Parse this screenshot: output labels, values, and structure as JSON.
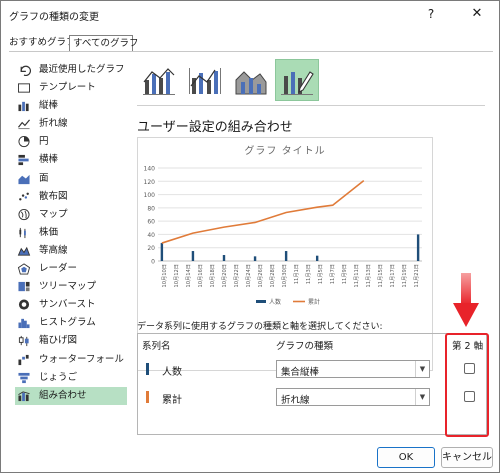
{
  "window": {
    "title": "グラフの種類の変更",
    "help": "?",
    "close": "✕"
  },
  "tabs": {
    "recommended": "おすすめグラフ",
    "all": "すべてのグラフ"
  },
  "sidebar": {
    "items": [
      {
        "label": "最近使用したグラフ",
        "icon": "undo-icon"
      },
      {
        "label": "テンプレート",
        "icon": "folder-icon"
      },
      {
        "label": "縦棒",
        "icon": "column-chart-icon"
      },
      {
        "label": "折れ線",
        "icon": "line-chart-icon"
      },
      {
        "label": "円",
        "icon": "pie-chart-icon"
      },
      {
        "label": "横棒",
        "icon": "bar-chart-icon"
      },
      {
        "label": "面",
        "icon": "area-chart-icon"
      },
      {
        "label": "散布図",
        "icon": "scatter-chart-icon"
      },
      {
        "label": "マップ",
        "icon": "map-chart-icon"
      },
      {
        "label": "株価",
        "icon": "stock-chart-icon"
      },
      {
        "label": "等高線",
        "icon": "surface-chart-icon"
      },
      {
        "label": "レーダー",
        "icon": "radar-chart-icon"
      },
      {
        "label": "ツリーマップ",
        "icon": "treemap-icon"
      },
      {
        "label": "サンバースト",
        "icon": "sunburst-icon"
      },
      {
        "label": "ヒストグラム",
        "icon": "histogram-icon"
      },
      {
        "label": "箱ひげ図",
        "icon": "box-whisker-icon"
      },
      {
        "label": "ウォーターフォール",
        "icon": "waterfall-icon"
      },
      {
        "label": "じょうご",
        "icon": "funnel-icon"
      },
      {
        "label": "組み合わせ",
        "icon": "combo-chart-icon"
      }
    ],
    "selected_index": 18
  },
  "main": {
    "heading": "ユーザー設定の組み合わせ",
    "selected_subtype": 3,
    "instruction": "データ系列に使用するグラフの種類と軸を選択してください:",
    "headers": {
      "series": "系列名",
      "type": "グラフの種類",
      "axis": "第 2 軸"
    },
    "series_rows": [
      {
        "name": "人数",
        "type": "集合縦棒",
        "color": "#1f4e79",
        "secondary_axis": false
      },
      {
        "name": "累計",
        "type": "折れ線",
        "color": "#e07b39",
        "secondary_axis": false
      }
    ]
  },
  "buttons": {
    "ok": "OK",
    "cancel": "キャンセル"
  },
  "colors": {
    "accent_green": "#aadcb5",
    "selection_green": "#b7e0c4",
    "callout_red": "#e8232a",
    "ok_border": "#1a73c8"
  },
  "chart_data": {
    "type": "bar",
    "title": "グラフ タイトル",
    "categories": [
      "10月10日",
      "10月12日",
      "10月14日",
      "10月16日",
      "10月18日",
      "10月20日",
      "10月22日",
      "10月24日",
      "10月26日",
      "10月28日",
      "10月30日",
      "11月1日",
      "11月3日",
      "11月5日",
      "11月7日",
      "11月9日",
      "11月11日",
      "11月13日",
      "11月15日",
      "11月17日",
      "11月19日",
      "11月21日"
    ],
    "series": [
      {
        "name": "人数",
        "kind": "bar",
        "color": "#1f4e79",
        "values": [
          27,
          0,
          0,
          0,
          15,
          0,
          0,
          0,
          9,
          0,
          0,
          0,
          7,
          0,
          0,
          0,
          15,
          0,
          0,
          0,
          8,
          0,
          0,
          0,
          0,
          0,
          0,
          0,
          0,
          0,
          0,
          0,
          0,
          40
        ]
      },
      {
        "name": "累計",
        "kind": "line",
        "color": "#e07b39",
        "points": [
          [
            0,
            27
          ],
          [
            4,
            42
          ],
          [
            8,
            51
          ],
          [
            12,
            58
          ],
          [
            16,
            73
          ],
          [
            20,
            81
          ],
          [
            22,
            84
          ],
          [
            26,
            121
          ]
        ]
      }
    ],
    "ylim": [
      0,
      140
    ],
    "yticks": [
      0,
      20,
      40,
      60,
      80,
      100,
      120,
      140
    ],
    "grid": true,
    "legend": "bottom"
  }
}
